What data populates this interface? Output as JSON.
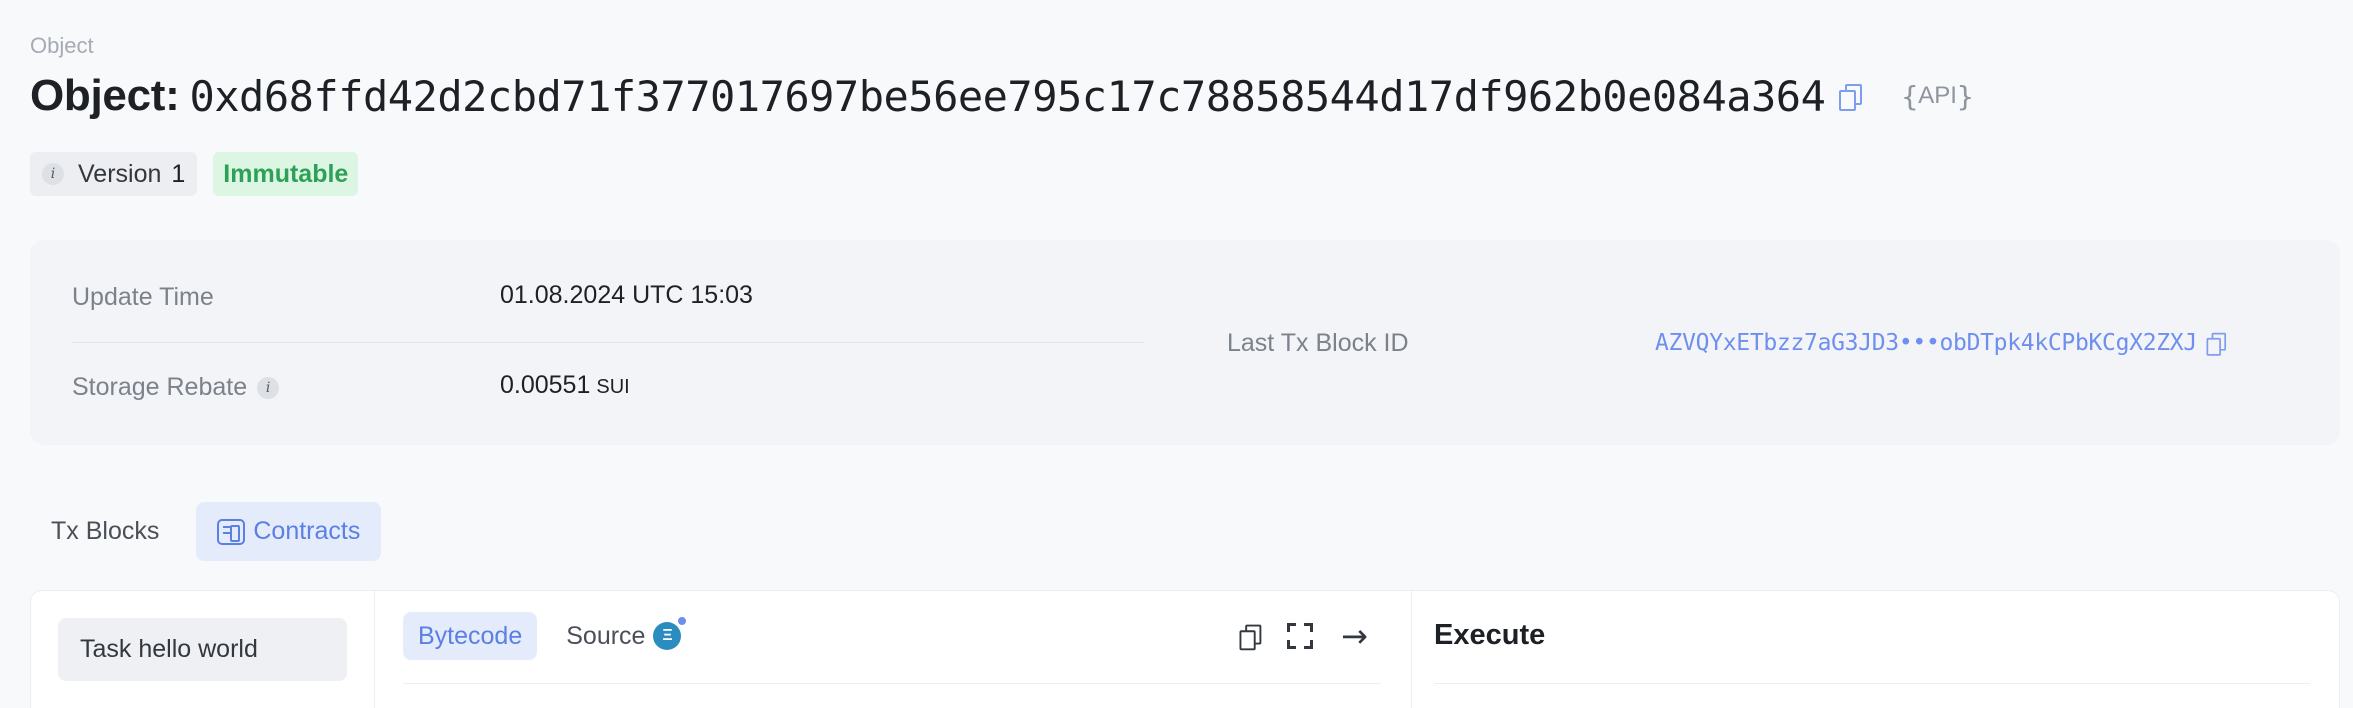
{
  "breadcrumb": "Object",
  "title": {
    "label": "Object:",
    "id": "0xd68ffd42d2cbd71f377017697be56ee795c17c78858544d17df962b0e084a364",
    "api_label": "API"
  },
  "badges": {
    "version_label": "Version",
    "version_value": "1",
    "info_glyph": "i",
    "status": "Immutable"
  },
  "details": {
    "update_time_label": "Update Time",
    "update_time_value": "01.08.2024 UTC 15:03",
    "storage_rebate_label": "Storage Rebate",
    "storage_rebate_value": "0.00551",
    "storage_rebate_unit": "SUI",
    "last_tx_label": "Last Tx Block ID",
    "last_tx_value": "AZVQYxETbzz7aG3JD3•••obDTpk4kCPbKCgX2ZXJ"
  },
  "tabs": [
    {
      "label": "Tx Blocks",
      "icon": "",
      "active": false
    },
    {
      "label": "Contracts",
      "icon": "contract-icon",
      "active": true
    }
  ],
  "contracts": {
    "task_item": "Task hello world",
    "sub_tabs": [
      {
        "label": "Bytecode",
        "active": true
      },
      {
        "label": "Source",
        "active": false
      }
    ],
    "source_icon_glyph": "Ξ",
    "execute_title": "Execute"
  },
  "colors": {
    "accent": "#5b7fe3",
    "link": "#6f8ff0",
    "immutable_bg": "#ddf5e3",
    "immutable_text": "#2ea057"
  }
}
